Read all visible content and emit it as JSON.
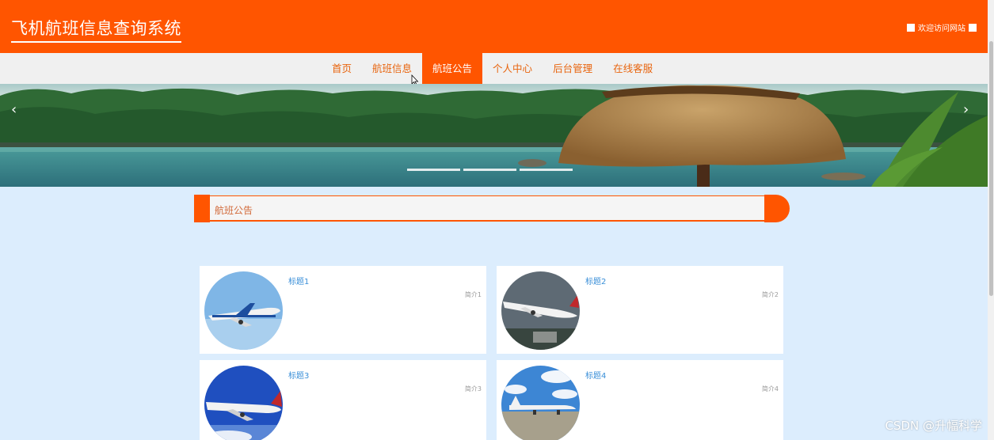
{
  "header": {
    "site_title": "飞机航班信息查询系统",
    "welcome": "欢迎访问网站"
  },
  "nav": {
    "items": [
      "首页",
      "航班信息",
      "航班公告",
      "个人中心",
      "后台管理",
      "在线客服"
    ],
    "active_index": 2
  },
  "banner": {
    "prev_icon": "chevron-left-icon",
    "next_icon": "chevron-right-icon",
    "slide_count": 3
  },
  "section": {
    "title": "航班公告"
  },
  "cards": [
    {
      "title": "标题1",
      "intro": "简介1"
    },
    {
      "title": "标题2",
      "intro": "简介2"
    },
    {
      "title": "标题3",
      "intro": "简介3"
    },
    {
      "title": "标题4",
      "intro": "简介4"
    }
  ],
  "watermark": "CSDN @升幅科学",
  "colors": {
    "brand": "#ff5500",
    "page_bg": "#dcedfd",
    "nav_bg": "#f0f0f0",
    "card_title": "#3a8fd8"
  }
}
